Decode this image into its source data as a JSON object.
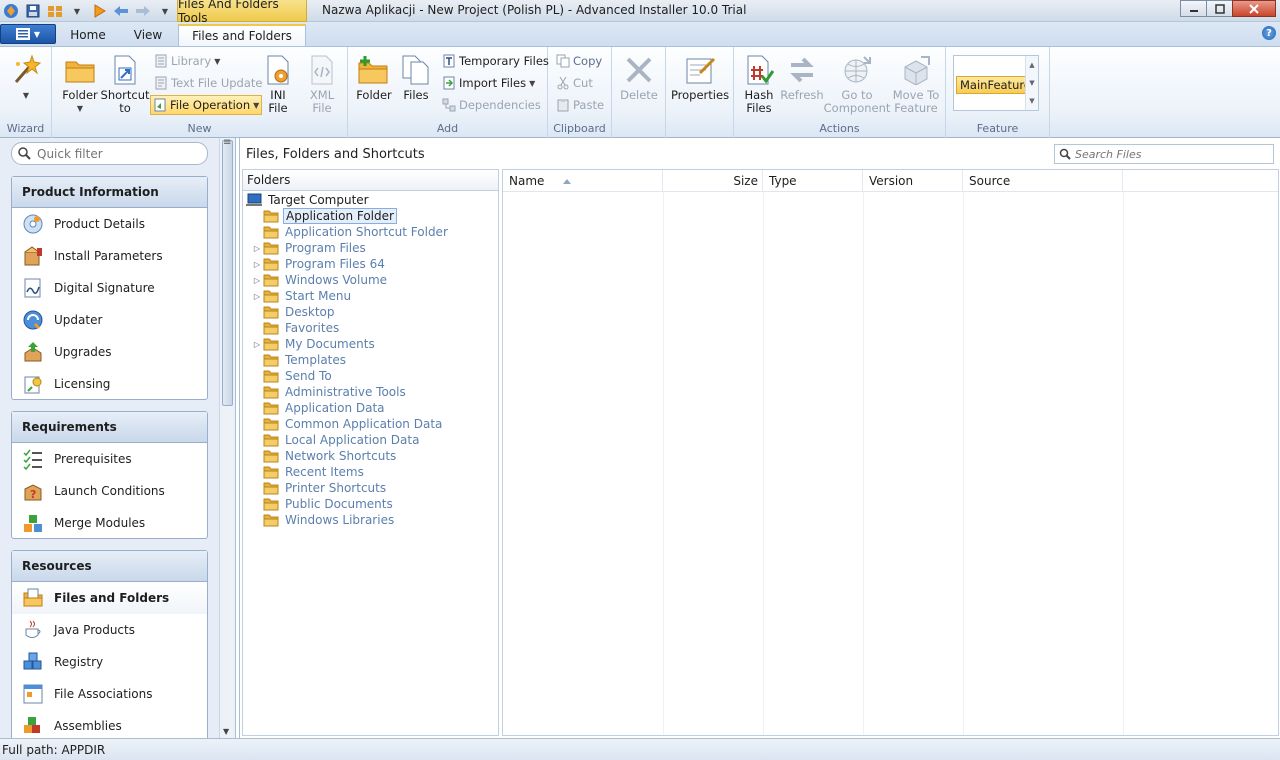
{
  "window": {
    "context_tab": "Files And Folders Tools",
    "title": "Nazwa Aplikacji - New Project (Polish PL) - Advanced Installer 10.0 Trial"
  },
  "tabs": [
    {
      "label": "Home"
    },
    {
      "label": "View"
    },
    {
      "label": "Files and Folders",
      "active": true
    }
  ],
  "ribbon": {
    "wizard": {
      "group_label": "Wizard"
    },
    "new": {
      "group_label": "New",
      "folder": "Folder",
      "shortcut_to": "Shortcut\nto",
      "library": "Library",
      "text_file_update": "Text File Update",
      "file_operation": "File Operation",
      "ini_file": "INI\nFile",
      "xml_file": "XML\nFile"
    },
    "add": {
      "group_label": "Add",
      "folder": "Folder",
      "files": "Files",
      "temporary_files": "Temporary Files",
      "import_files": "Import Files",
      "dependencies": "Dependencies"
    },
    "clipboard": {
      "group_label": "Clipboard",
      "copy": "Copy",
      "cut": "Cut",
      "paste": "Paste",
      "delete": "Delete"
    },
    "properties": "Properties",
    "actions": {
      "group_label": "Actions",
      "hash_files": "Hash\nFiles",
      "refresh": "Refresh",
      "go_to_component": "Go to\nComponent",
      "move_to_feature": "Move To\nFeature"
    },
    "feature": {
      "group_label": "Feature",
      "selected": "MainFeature"
    }
  },
  "leftnav": {
    "filter_placeholder": "Quick filter",
    "sections": [
      {
        "title": "Product Information",
        "items": [
          "Product Details",
          "Install Parameters",
          "Digital Signature",
          "Updater",
          "Upgrades",
          "Licensing"
        ]
      },
      {
        "title": "Requirements",
        "items": [
          "Prerequisites",
          "Launch Conditions",
          "Merge Modules"
        ]
      },
      {
        "title": "Resources",
        "items": [
          "Files and Folders",
          "Java Products",
          "Registry",
          "File Associations",
          "Assemblies"
        ]
      }
    ]
  },
  "content": {
    "title": "Files, Folders and Shortcuts",
    "search_placeholder": "Search Files",
    "folders_header": "Folders",
    "tree_root": "Target Computer",
    "tree": [
      {
        "label": "Application Folder",
        "selected": true
      },
      {
        "label": "Application Shortcut Folder"
      },
      {
        "label": "Program Files",
        "expandable": true
      },
      {
        "label": "Program Files 64",
        "expandable": true
      },
      {
        "label": "Windows Volume",
        "expandable": true
      },
      {
        "label": "Start Menu",
        "expandable": true
      },
      {
        "label": "Desktop"
      },
      {
        "label": "Favorites"
      },
      {
        "label": "My Documents",
        "expandable": true
      },
      {
        "label": "Templates"
      },
      {
        "label": "Send To"
      },
      {
        "label": "Administrative Tools"
      },
      {
        "label": "Application Data"
      },
      {
        "label": "Common Application Data"
      },
      {
        "label": "Local Application Data"
      },
      {
        "label": "Network Shortcuts"
      },
      {
        "label": "Recent Items"
      },
      {
        "label": "Printer Shortcuts"
      },
      {
        "label": "Public Documents"
      },
      {
        "label": "Windows Libraries"
      }
    ],
    "columns": [
      "Name",
      "Size",
      "Type",
      "Version",
      "Source"
    ]
  },
  "statusbar": {
    "text": "Full path: APPDIR"
  },
  "colors": {
    "accent": "#efc94c",
    "selection_border": "#88aee0",
    "tree_text": "#5b7fae"
  }
}
